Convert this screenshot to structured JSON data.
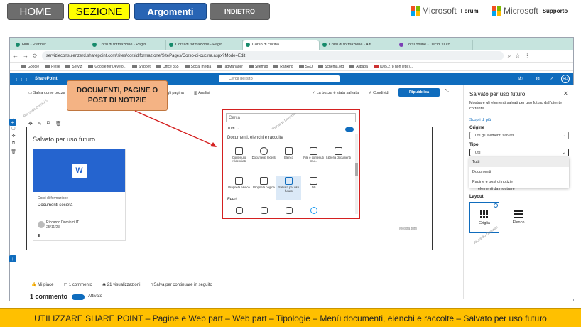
{
  "nav": {
    "home": "HOME",
    "sezione": "SEZIONE",
    "argomenti": "Argomenti",
    "indietro": "INDIETRO"
  },
  "brand": {
    "word": "Microsoft",
    "forum": "Forum",
    "supporto": "Supporto",
    "colors": [
      "#f25022",
      "#7fba00",
      "#00a4ef",
      "#ffb900"
    ]
  },
  "browser": {
    "tabs": [
      "Hub - Planner",
      "Corsi di formazione - Pagin...",
      "Corsi di formazione - Pagin...",
      "Corso di cucina",
      "Corsi di formazione - Alti...",
      "Corsi online - Decidi tu co..."
    ],
    "url": "servizieconsulenzerd.sharepoint.com/sites/corsidiformazione/SitePages/Corso-di-cucina.aspx?Mode=Edit",
    "bookmarks": [
      "Google",
      "Plesk",
      "Servizi",
      "Google for Develo...",
      "Snippet",
      "Office 365",
      "Social media",
      "TagManager",
      "Sitemap",
      "Ranking",
      "SEO",
      "Schema.org",
      "Alibaba",
      "(105.278 non lette)..."
    ]
  },
  "sp": {
    "brand": "SharePoint",
    "search": "Cerca nel sito",
    "avatar": "RD",
    "accent": "#0f6cbd"
  },
  "cmd": {
    "save_later": "Salva come bozza",
    "details": "Dettagli pagina",
    "analytics": "Analisi",
    "draft_saved": "La bozza è stata salvata",
    "share": "Condividi",
    "publish": "Ripubblica"
  },
  "callout": "DOCUMENTI, PAGINE O POST DI NOTIZIE",
  "webpart": {
    "title": "Salvato per uso futuro",
    "show_all": "Mostra tutti"
  },
  "card": {
    "category": "Corsi di formazione",
    "title": "Documenti società",
    "author": "Riccardo Dominici IT",
    "date": "25/11/23"
  },
  "picker": {
    "search": "Cerca",
    "filter": "Tutti",
    "section1": "Documenti, elenchi e raccolte",
    "items": [
      "Contenuto evidenziato",
      "Documenti recenti",
      "Elenco",
      "File e contenuti mu...",
      "Libreria documenti",
      "Proprietà elenco",
      "Proprietà pagina",
      "Salvato per uso futuro",
      "Siti"
    ],
    "section2": "Feed"
  },
  "social": {
    "like": "Mi piace",
    "comments": "1 commento",
    "views": "21 visualizzazioni",
    "save": "Salva per continuare in seguito",
    "comment_count": "1 commento",
    "enabled": "Attivato"
  },
  "pane": {
    "title": "Salvato per uso futuro",
    "desc": "Mostrare gli elementi salvati per uso futuro dall'utente corrente.",
    "learn": "Scopri di più",
    "origin_label": "Origine",
    "origin_value": "Tutti gli elementi salvati",
    "type_label": "Tipo",
    "type_value": "Tutti",
    "options": [
      "Tutti",
      "Documenti",
      "Pagine e post di notizie"
    ],
    "under": "elementi da mostrare",
    "layout_label": "Layout",
    "layout_grid": "Griglia",
    "layout_list": "Elenco"
  },
  "watermark": "Riccardo Dominici",
  "banner": "UTILIZZARE SHARE POINT – Pagine e Web part – Web part – Tipologie – Menù documenti, elenchi e raccolte – Salvato per uso futuro"
}
